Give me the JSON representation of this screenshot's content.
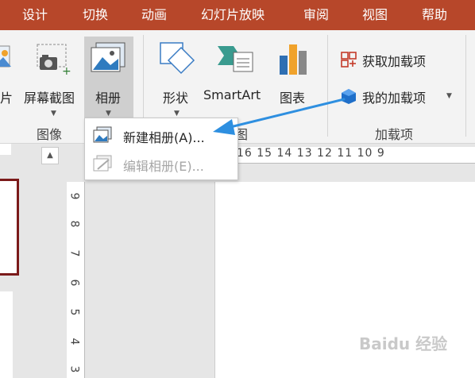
{
  "tabs": [
    {
      "label": "设计"
    },
    {
      "label": "切换"
    },
    {
      "label": "动画"
    },
    {
      "label": "幻灯片放映"
    },
    {
      "label": "审阅"
    },
    {
      "label": "视图"
    },
    {
      "label": "帮助"
    }
  ],
  "ribbon": {
    "images_group": {
      "group_label": "图像",
      "pictures_partial": "片",
      "screenshot_label": "屏幕截图",
      "album_label": "相册"
    },
    "illustrations_group": {
      "group_label_partial": "图",
      "shapes_label": "形状",
      "smartart_label": "SmartArt",
      "chart_label": "图表"
    },
    "addins_group": {
      "group_label": "加载项",
      "get_addins_label": "获取加载项",
      "my_addins_label": "我的加载项"
    }
  },
  "album_menu": {
    "items": [
      {
        "label": "新建相册(A)...",
        "enabled": true
      },
      {
        "label": "编辑相册(E)...",
        "enabled": false
      }
    ]
  },
  "ruler": {
    "horizontal": "16 15 14 13 12 11 10 9",
    "vertical": [
      "9",
      "8",
      "7",
      "6",
      "5",
      "4",
      "3"
    ]
  },
  "colors": {
    "tab_bar": "#b7472a",
    "arrow": "#2e8fe0",
    "selected_slide_border": "#7b1a1a"
  },
  "watermark": "Baidu 经验"
}
